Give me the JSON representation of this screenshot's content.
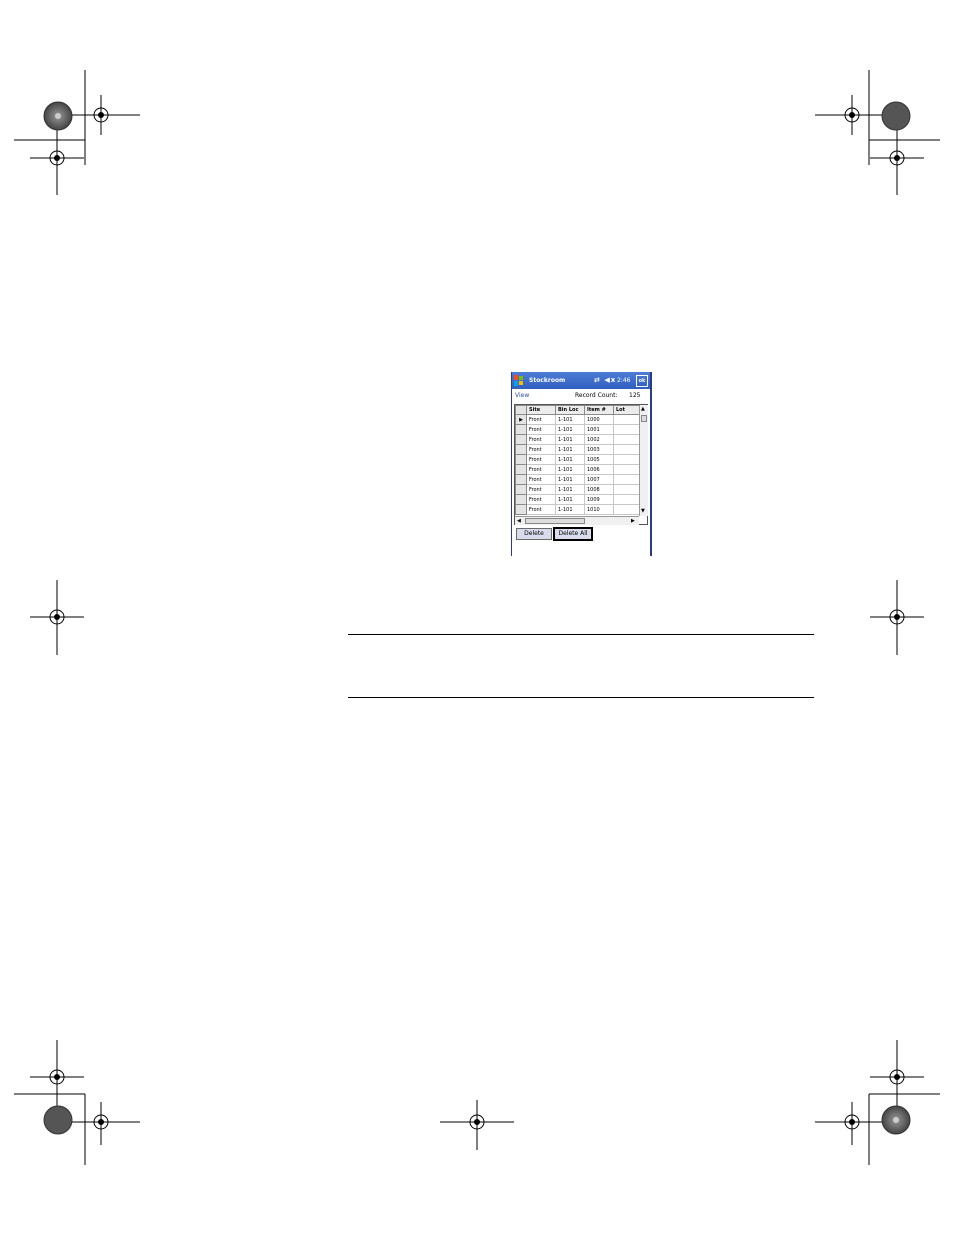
{
  "device": {
    "title": "Stockroom",
    "clock": "2:46",
    "ok": "ok",
    "status_icons": [
      "sync-icon",
      "speaker-muted-icon"
    ],
    "menu_view": "View",
    "record_count_label": "Record Count:",
    "record_count_value": "125",
    "columns": [
      "Site",
      "Bin Loc",
      "Item #",
      "Lot"
    ],
    "rows": [
      [
        "Front",
        "1-101",
        "1000",
        ""
      ],
      [
        "Front",
        "1-101",
        "1001",
        ""
      ],
      [
        "Front",
        "1-101",
        "1002",
        ""
      ],
      [
        "Front",
        "1-101",
        "1003",
        ""
      ],
      [
        "Front",
        "1-101",
        "1005",
        ""
      ],
      [
        "Front",
        "1-101",
        "1006",
        ""
      ],
      [
        "Front",
        "1-101",
        "1007",
        ""
      ],
      [
        "Front",
        "1-101",
        "1008",
        ""
      ],
      [
        "Front",
        "1-101",
        "1009",
        ""
      ],
      [
        "Front",
        "1-101",
        "1010",
        ""
      ]
    ],
    "delete_label": "Delete",
    "delete_all_label": "Delete All"
  },
  "colors": {
    "titlebar": "#2f5fc0",
    "window_border": "#2a3a8c"
  }
}
